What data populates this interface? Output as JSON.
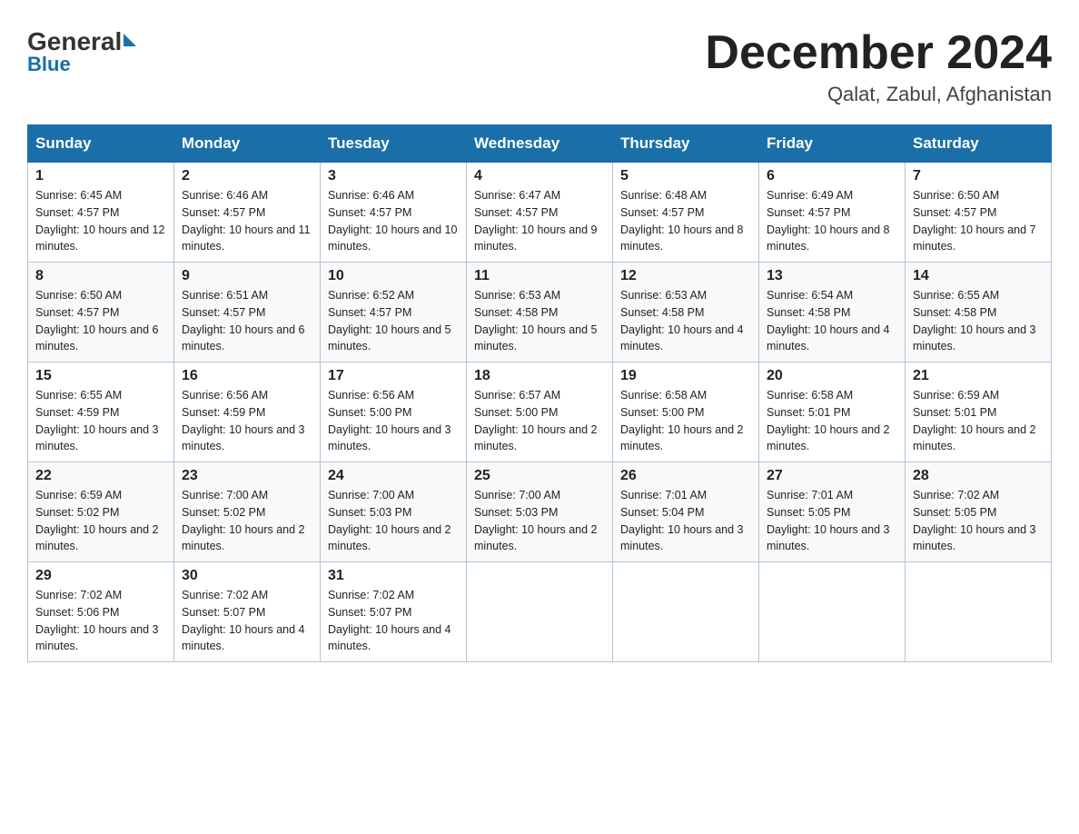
{
  "logo": {
    "general": "General",
    "blue": "Blue"
  },
  "header": {
    "month": "December 2024",
    "location": "Qalat, Zabul, Afghanistan"
  },
  "weekdays": [
    "Sunday",
    "Monday",
    "Tuesday",
    "Wednesday",
    "Thursday",
    "Friday",
    "Saturday"
  ],
  "weeks": [
    [
      {
        "day": 1,
        "sunrise": "6:45 AM",
        "sunset": "4:57 PM",
        "daylight": "10 hours and 12 minutes."
      },
      {
        "day": 2,
        "sunrise": "6:46 AM",
        "sunset": "4:57 PM",
        "daylight": "10 hours and 11 minutes."
      },
      {
        "day": 3,
        "sunrise": "6:46 AM",
        "sunset": "4:57 PM",
        "daylight": "10 hours and 10 minutes."
      },
      {
        "day": 4,
        "sunrise": "6:47 AM",
        "sunset": "4:57 PM",
        "daylight": "10 hours and 9 minutes."
      },
      {
        "day": 5,
        "sunrise": "6:48 AM",
        "sunset": "4:57 PM",
        "daylight": "10 hours and 8 minutes."
      },
      {
        "day": 6,
        "sunrise": "6:49 AM",
        "sunset": "4:57 PM",
        "daylight": "10 hours and 8 minutes."
      },
      {
        "day": 7,
        "sunrise": "6:50 AM",
        "sunset": "4:57 PM",
        "daylight": "10 hours and 7 minutes."
      }
    ],
    [
      {
        "day": 8,
        "sunrise": "6:50 AM",
        "sunset": "4:57 PM",
        "daylight": "10 hours and 6 minutes."
      },
      {
        "day": 9,
        "sunrise": "6:51 AM",
        "sunset": "4:57 PM",
        "daylight": "10 hours and 6 minutes."
      },
      {
        "day": 10,
        "sunrise": "6:52 AM",
        "sunset": "4:57 PM",
        "daylight": "10 hours and 5 minutes."
      },
      {
        "day": 11,
        "sunrise": "6:53 AM",
        "sunset": "4:58 PM",
        "daylight": "10 hours and 5 minutes."
      },
      {
        "day": 12,
        "sunrise": "6:53 AM",
        "sunset": "4:58 PM",
        "daylight": "10 hours and 4 minutes."
      },
      {
        "day": 13,
        "sunrise": "6:54 AM",
        "sunset": "4:58 PM",
        "daylight": "10 hours and 4 minutes."
      },
      {
        "day": 14,
        "sunrise": "6:55 AM",
        "sunset": "4:58 PM",
        "daylight": "10 hours and 3 minutes."
      }
    ],
    [
      {
        "day": 15,
        "sunrise": "6:55 AM",
        "sunset": "4:59 PM",
        "daylight": "10 hours and 3 minutes."
      },
      {
        "day": 16,
        "sunrise": "6:56 AM",
        "sunset": "4:59 PM",
        "daylight": "10 hours and 3 minutes."
      },
      {
        "day": 17,
        "sunrise": "6:56 AM",
        "sunset": "5:00 PM",
        "daylight": "10 hours and 3 minutes."
      },
      {
        "day": 18,
        "sunrise": "6:57 AM",
        "sunset": "5:00 PM",
        "daylight": "10 hours and 2 minutes."
      },
      {
        "day": 19,
        "sunrise": "6:58 AM",
        "sunset": "5:00 PM",
        "daylight": "10 hours and 2 minutes."
      },
      {
        "day": 20,
        "sunrise": "6:58 AM",
        "sunset": "5:01 PM",
        "daylight": "10 hours and 2 minutes."
      },
      {
        "day": 21,
        "sunrise": "6:59 AM",
        "sunset": "5:01 PM",
        "daylight": "10 hours and 2 minutes."
      }
    ],
    [
      {
        "day": 22,
        "sunrise": "6:59 AM",
        "sunset": "5:02 PM",
        "daylight": "10 hours and 2 minutes."
      },
      {
        "day": 23,
        "sunrise": "7:00 AM",
        "sunset": "5:02 PM",
        "daylight": "10 hours and 2 minutes."
      },
      {
        "day": 24,
        "sunrise": "7:00 AM",
        "sunset": "5:03 PM",
        "daylight": "10 hours and 2 minutes."
      },
      {
        "day": 25,
        "sunrise": "7:00 AM",
        "sunset": "5:03 PM",
        "daylight": "10 hours and 2 minutes."
      },
      {
        "day": 26,
        "sunrise": "7:01 AM",
        "sunset": "5:04 PM",
        "daylight": "10 hours and 3 minutes."
      },
      {
        "day": 27,
        "sunrise": "7:01 AM",
        "sunset": "5:05 PM",
        "daylight": "10 hours and 3 minutes."
      },
      {
        "day": 28,
        "sunrise": "7:02 AM",
        "sunset": "5:05 PM",
        "daylight": "10 hours and 3 minutes."
      }
    ],
    [
      {
        "day": 29,
        "sunrise": "7:02 AM",
        "sunset": "5:06 PM",
        "daylight": "10 hours and 3 minutes."
      },
      {
        "day": 30,
        "sunrise": "7:02 AM",
        "sunset": "5:07 PM",
        "daylight": "10 hours and 4 minutes."
      },
      {
        "day": 31,
        "sunrise": "7:02 AM",
        "sunset": "5:07 PM",
        "daylight": "10 hours and 4 minutes."
      },
      null,
      null,
      null,
      null
    ]
  ],
  "labels": {
    "sunrise": "Sunrise:",
    "sunset": "Sunset:",
    "daylight": "Daylight:"
  }
}
